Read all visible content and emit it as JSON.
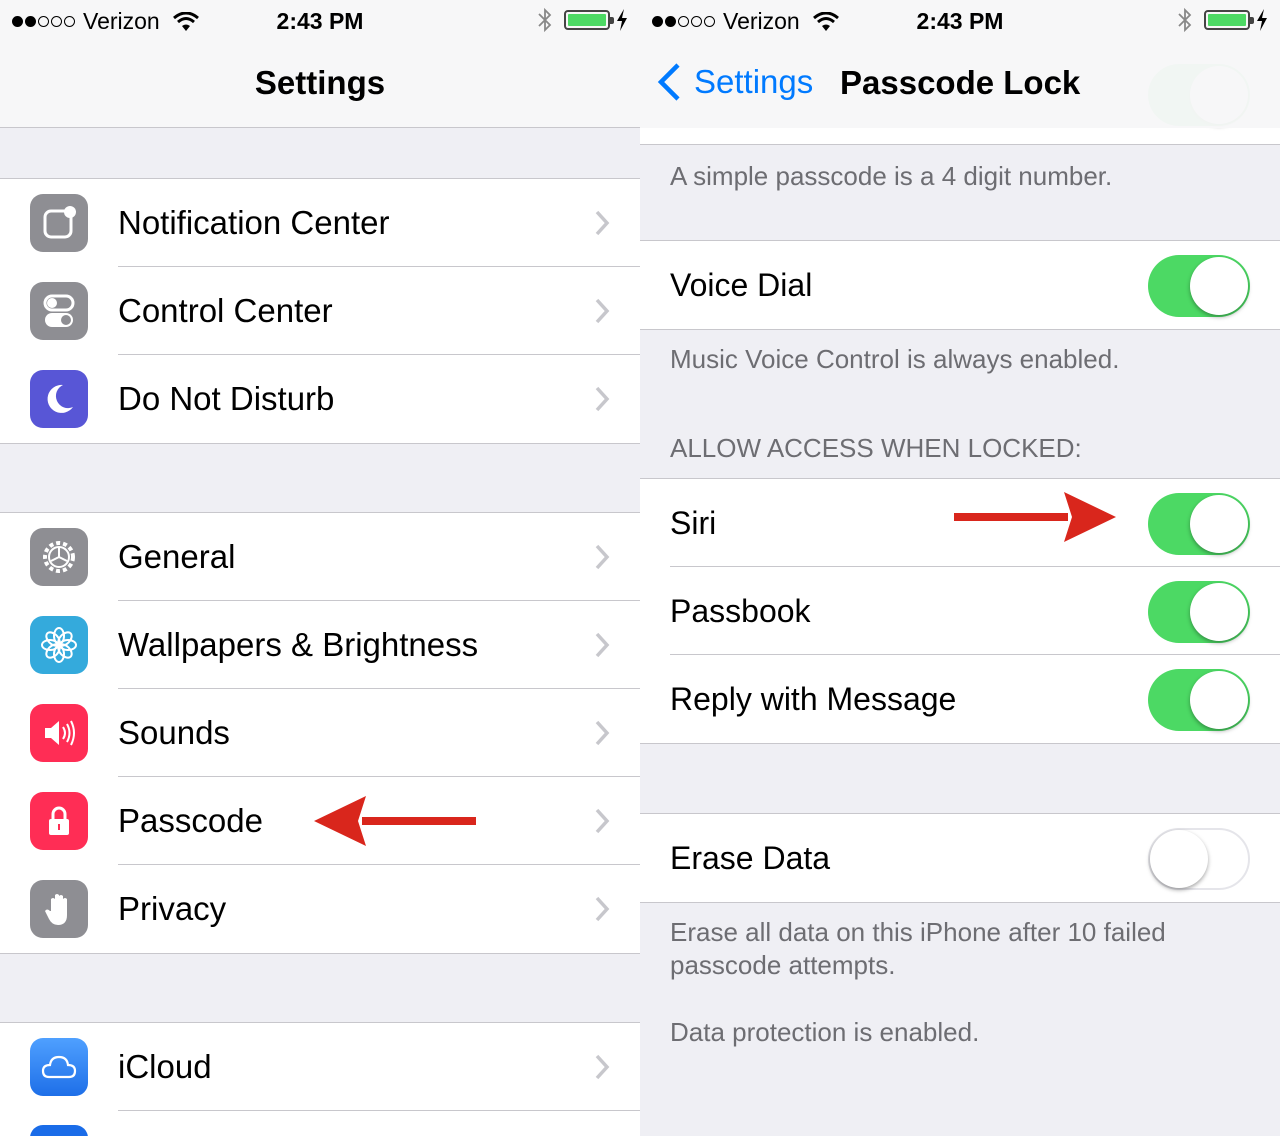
{
  "status": {
    "carrier": "Verizon",
    "time": "2:43 PM",
    "signal_bars": 2,
    "battery_color": "#4cd964"
  },
  "left": {
    "title": "Settings",
    "group1": [
      {
        "label": "Notification Center",
        "icon": "notification-center-icon",
        "color": "#8e8e93"
      },
      {
        "label": "Control Center",
        "icon": "control-center-icon",
        "color": "#8e8e93"
      },
      {
        "label": "Do Not Disturb",
        "icon": "moon-icon",
        "color": "#5856d6"
      }
    ],
    "group2": [
      {
        "label": "General",
        "icon": "gear-icon",
        "color": "#8e8e93"
      },
      {
        "label": "Wallpapers & Brightness",
        "icon": "flower-icon",
        "color": "#34aadc"
      },
      {
        "label": "Sounds",
        "icon": "speaker-icon",
        "color": "#ff2d55"
      },
      {
        "label": "Passcode",
        "icon": "lock-icon",
        "color": "#ff2d55"
      },
      {
        "label": "Privacy",
        "icon": "hand-icon",
        "color": "#8e8e93"
      }
    ],
    "group3": [
      {
        "label": "iCloud",
        "icon": "cloud-icon",
        "color": "#1e90ff"
      }
    ]
  },
  "right": {
    "back_label": "Settings",
    "title": "Passcode Lock",
    "simple_footer": "A simple passcode is a 4 digit number.",
    "voice_dial": {
      "label": "Voice Dial",
      "on": true
    },
    "voice_footer": "Music Voice Control is always enabled.",
    "locked_header": "ALLOW ACCESS WHEN LOCKED:",
    "locked_rows": [
      {
        "label": "Siri",
        "on": true
      },
      {
        "label": "Passbook",
        "on": true
      },
      {
        "label": "Reply with Message",
        "on": true
      }
    ],
    "erase": {
      "label": "Erase Data",
      "on": false
    },
    "erase_footer": "Erase all data on this iPhone after 10 failed passcode attempts.",
    "protection_footer": "Data protection is enabled."
  },
  "annotation_color": "#d9261c"
}
